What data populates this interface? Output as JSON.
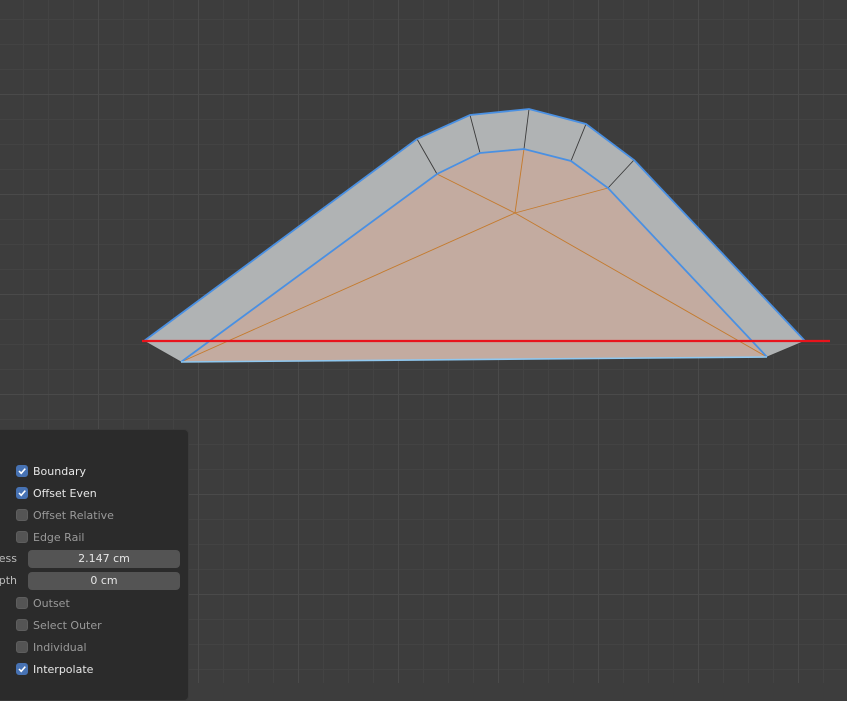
{
  "panel": {
    "options": [
      {
        "label": "Boundary",
        "checked": true
      },
      {
        "label": "Offset Even",
        "checked": true
      },
      {
        "label": "Offset Relative",
        "checked": false
      },
      {
        "label": "Edge Rail",
        "checked": false
      }
    ],
    "thickness": {
      "label": "ess",
      "value": "2.147 cm"
    },
    "depth": {
      "label": "pth",
      "value": "0 cm"
    },
    "options2": [
      {
        "label": "Outset",
        "checked": false
      },
      {
        "label": "Select Outer",
        "checked": false
      },
      {
        "label": "Individual",
        "checked": false
      },
      {
        "label": "Interpolate",
        "checked": true
      }
    ]
  },
  "colors": {
    "viewport_bg": "#3d3d3d",
    "face_selected": "#c3aba0",
    "face_inset": "#b0b3b4",
    "edge_selected": "#4a90e2",
    "axis_x": "#e8141c",
    "checkbox_on": "#4772b3"
  }
}
